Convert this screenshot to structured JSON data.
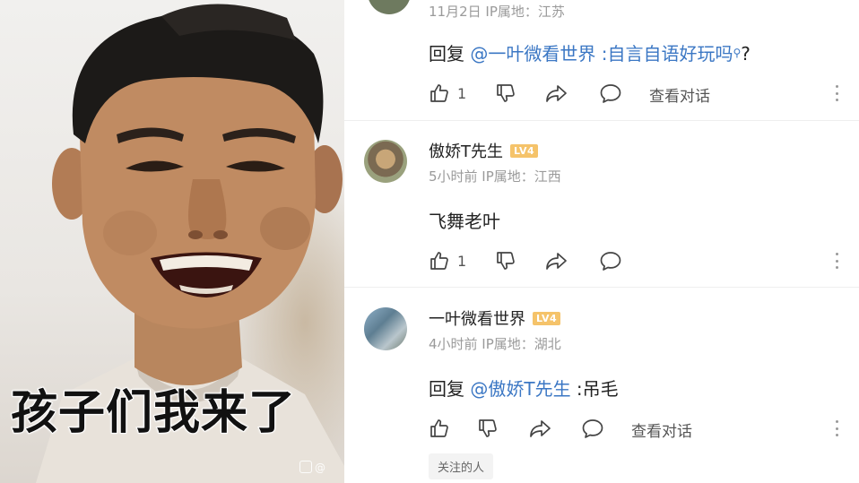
{
  "meme": {
    "caption": "孩子们我来了",
    "watermark": "@"
  },
  "comments": [
    {
      "meta": "11月2日  IP属地：江苏",
      "reply_prefix": "回复 ",
      "mention": "@一叶微看世界",
      "text": " :自言自语好玩吗",
      "search_glyph": "⚲",
      "trailing": "?",
      "likes": "1",
      "view_conversation": "查看对话"
    },
    {
      "username": "傲娇T先生",
      "level": "LV4",
      "meta": "5小时前  IP属地：江西",
      "text": "飞舞老叶",
      "likes": "1"
    },
    {
      "username": "一叶微看世界",
      "level": "LV4",
      "meta": "4小时前  IP属地：湖北",
      "reply_prefix": "回复 ",
      "mention": "@傲娇T先生",
      "text": " :吊毛",
      "view_conversation": "查看对话"
    }
  ],
  "follow_chip": "关注的人",
  "colors": {
    "mention": "#3b77c4",
    "badge": "#f5c36a",
    "meta": "#9a9a9a"
  }
}
